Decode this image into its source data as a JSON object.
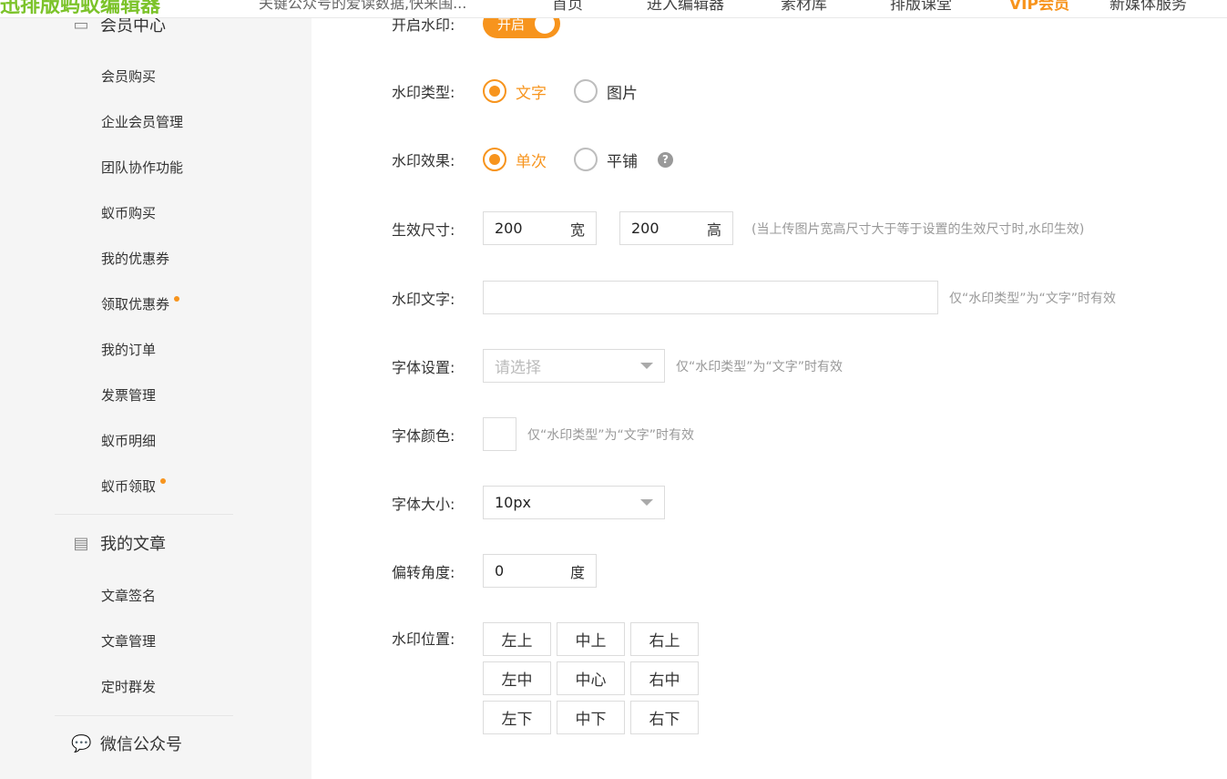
{
  "topbar": {
    "logo": "迅排版蚂蚁编辑器",
    "notice": "关键公众号的爱读数据,快来围...",
    "nav": [
      "首页",
      "进入编辑器",
      "素材库",
      "排版课堂",
      "VIP会员",
      "新媒体服务"
    ]
  },
  "sidebar": {
    "member_center": "会员中心",
    "member_items": [
      "会员购买",
      "企业会员管理",
      "团队协作功能",
      "蚁币购买",
      "我的优惠券",
      "领取优惠券",
      "我的订单",
      "发票管理",
      "蚁币明细",
      "蚁币领取"
    ],
    "my_articles": "我的文章",
    "article_items": [
      "文章签名",
      "文章管理",
      "定时群发"
    ],
    "wechat": "微信公众号",
    "accent_color": "#f7941d"
  },
  "form": {
    "enable": {
      "label": "开启水印:",
      "toggle_text": "开启",
      "on": true
    },
    "type": {
      "label": "水印类型:",
      "options": [
        "文字",
        "图片"
      ],
      "selected": "文字"
    },
    "effect": {
      "label": "水印效果:",
      "options": [
        "单次",
        "平铺"
      ],
      "selected": "单次"
    },
    "size": {
      "label": "生效尺寸:",
      "width": "200",
      "width_unit": "宽",
      "height": "200",
      "height_unit": "高",
      "hint": "(当上传图片宽高尺寸大于等于设置的生效尺寸时,水印生效)"
    },
    "text": {
      "label": "水印文字:",
      "value": "",
      "hint": "仅“水印类型”为“文字”时有效"
    },
    "font": {
      "label": "字体设置:",
      "placeholder": "请选择",
      "hint": "仅“水印类型”为“文字”时有效"
    },
    "color": {
      "label": "字体颜色:",
      "hint": "仅“水印类型”为“文字”时有效"
    },
    "font_size": {
      "label": "字体大小:",
      "value": "10px"
    },
    "angle": {
      "label": "偏转角度:",
      "value": "0",
      "unit": "度"
    },
    "position": {
      "label": "水印位置:",
      "options": [
        "左上",
        "中上",
        "右上",
        "左中",
        "中心",
        "右中",
        "左下",
        "中下",
        "右下"
      ]
    }
  }
}
